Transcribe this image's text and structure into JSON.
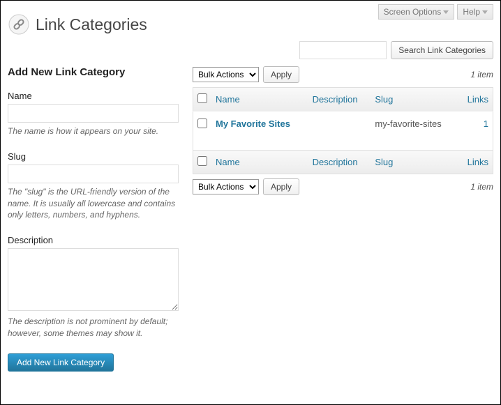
{
  "topbar": {
    "screen_options": "Screen Options",
    "help": "Help"
  },
  "page_title": "Link Categories",
  "search": {
    "placeholder": "",
    "button": "Search Link Categories"
  },
  "form": {
    "heading": "Add New Link Category",
    "name_label": "Name",
    "name_hint": "The name is how it appears on your site.",
    "slug_label": "Slug",
    "slug_hint": "The \"slug\" is the URL-friendly version of the name. It is usually all lowercase and contains only letters, numbers, and hyphens.",
    "desc_label": "Description",
    "desc_hint": "The description is not prominent by default; however, some themes may show it.",
    "submit": "Add New Link Category"
  },
  "bulk": {
    "label": "Bulk Actions",
    "apply": "Apply"
  },
  "count_text": "1 item",
  "columns": {
    "name": "Name",
    "description": "Description",
    "slug": "Slug",
    "links": "Links"
  },
  "rows": [
    {
      "name": "My Favorite Sites",
      "description": "",
      "slug": "my-favorite-sites",
      "links": "1"
    }
  ]
}
